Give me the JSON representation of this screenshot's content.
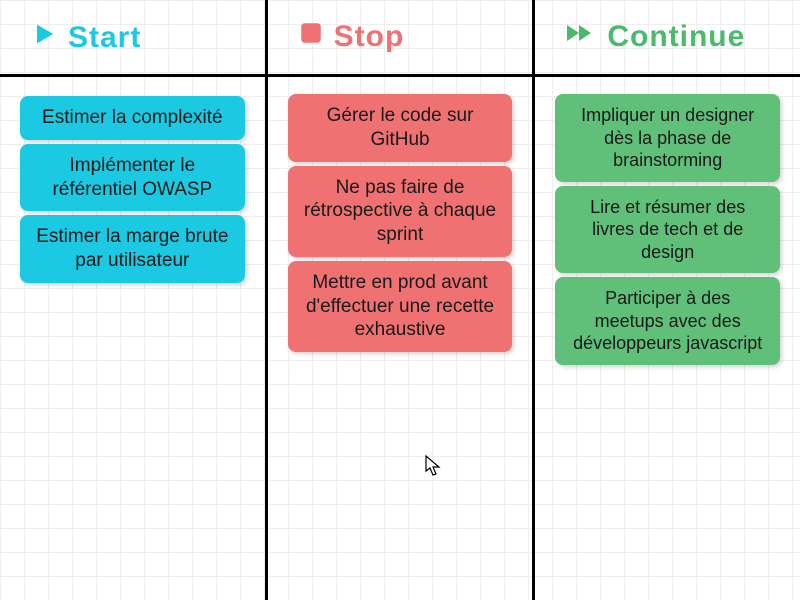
{
  "columns": [
    {
      "key": "start",
      "title": "Start",
      "color": "#1cc9e3",
      "cards": [
        "Estimer la complexité",
        "Implémenter le référentiel OWASP",
        "Estimer la marge brute par utilisateur"
      ]
    },
    {
      "key": "stop",
      "title": "Stop",
      "color": "#f07171",
      "cards": [
        "Gérer le code sur GitHub",
        "Ne pas faire de rétrospective à chaque sprint",
        "Mettre en prod avant d'effectuer une recette exhaustive"
      ]
    },
    {
      "key": "continue",
      "title": "Continue",
      "color": "#4aba6b",
      "cards": [
        "Impliquer un designer dès la phase de brainstorming",
        "Lire et résumer des livres de tech et de design",
        "Participer à des meetups avec des développeurs javascript"
      ]
    }
  ]
}
